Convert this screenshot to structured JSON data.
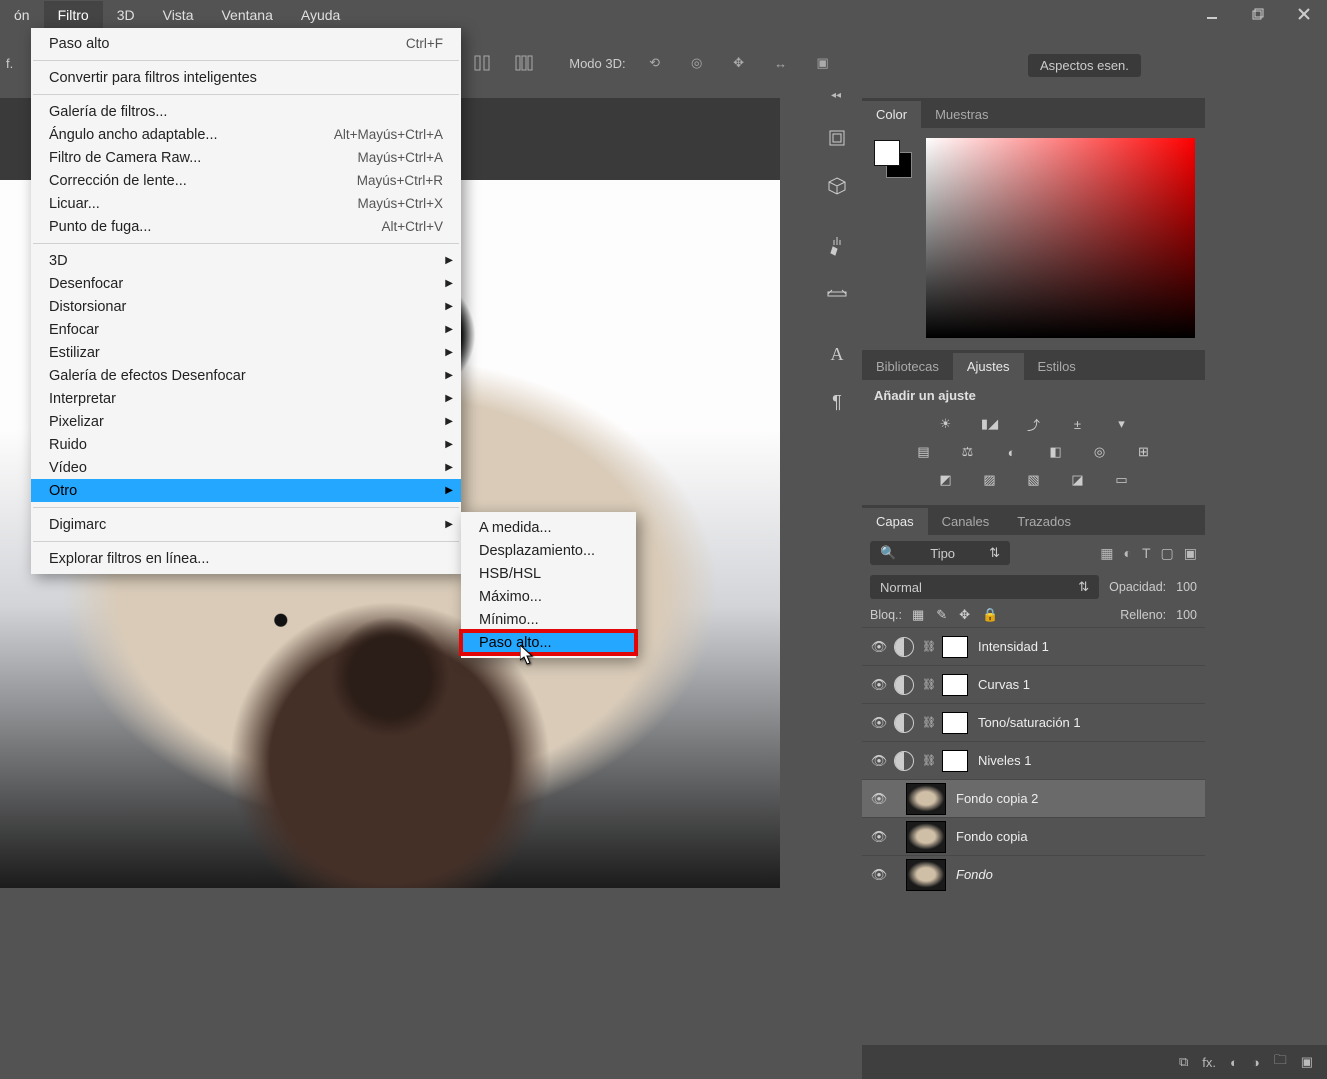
{
  "menubar": {
    "items_pre": "ón",
    "items": [
      "Filtro",
      "3D",
      "Vista",
      "Ventana",
      "Ayuda"
    ],
    "open_index": 0
  },
  "optionsbar": {
    "left": "f.",
    "modo3d_label": "Modo 3D:"
  },
  "aspectos_label": "Aspectos esen.",
  "filter_menu": {
    "sections": [
      [
        {
          "label": "Paso alto",
          "shortcut": "Ctrl+F"
        }
      ],
      [
        {
          "label": "Convertir para filtros inteligentes"
        }
      ],
      [
        {
          "label": "Galería de filtros..."
        },
        {
          "label": "Ángulo ancho adaptable...",
          "shortcut": "Alt+Mayús+Ctrl+A"
        },
        {
          "label": "Filtro de Camera Raw...",
          "shortcut": "Mayús+Ctrl+A"
        },
        {
          "label": "Corrección de lente...",
          "shortcut": "Mayús+Ctrl+R"
        },
        {
          "label": "Licuar...",
          "shortcut": "Mayús+Ctrl+X"
        },
        {
          "label": "Punto de fuga...",
          "shortcut": "Alt+Ctrl+V"
        }
      ],
      [
        {
          "label": "3D",
          "submenu": true
        },
        {
          "label": "Desenfocar",
          "submenu": true
        },
        {
          "label": "Distorsionar",
          "submenu": true
        },
        {
          "label": "Enfocar",
          "submenu": true
        },
        {
          "label": "Estilizar",
          "submenu": true
        },
        {
          "label": "Galería de efectos Desenfocar",
          "submenu": true
        },
        {
          "label": "Interpretar",
          "submenu": true
        },
        {
          "label": "Pixelizar",
          "submenu": true
        },
        {
          "label": "Ruido",
          "submenu": true
        },
        {
          "label": "Vídeo",
          "submenu": true
        },
        {
          "label": "Otro",
          "submenu": true,
          "selected": true
        }
      ],
      [
        {
          "label": "Digimarc",
          "submenu": true
        }
      ],
      [
        {
          "label": "Explorar filtros en línea..."
        }
      ]
    ]
  },
  "submenu_otro": [
    {
      "label": "A medida..."
    },
    {
      "label": "Desplazamiento..."
    },
    {
      "label": "HSB/HSL"
    },
    {
      "label": "Máximo..."
    },
    {
      "label": "Mínimo..."
    },
    {
      "label": "Paso alto...",
      "selected": true,
      "highlight": true
    }
  ],
  "panels": {
    "color_tabs": [
      "Color",
      "Muestras"
    ],
    "mid_tabs": [
      "Bibliotecas",
      "Ajustes",
      "Estilos"
    ],
    "mid_active": 1,
    "adjust_label": "Añadir un ajuste",
    "bottom_tabs": [
      "Capas",
      "Canales",
      "Trazados"
    ],
    "bottom_active": 0,
    "type_select_icon": "🔍",
    "type_select_label": "Tipo",
    "blend_mode": "Normal",
    "opacity_label": "Opacidad:",
    "opacity_value": "100",
    "lock_label": "Bloq.:",
    "fill_label": "Relleno:",
    "fill_value": "100",
    "layers": [
      {
        "name": "Intensidad 1",
        "adjustment": true
      },
      {
        "name": "Curvas 1",
        "adjustment": true
      },
      {
        "name": "Tono/saturación 1",
        "adjustment": true
      },
      {
        "name": "Niveles 1",
        "adjustment": true
      },
      {
        "name": "Fondo copia 2",
        "image": true,
        "selected": true
      },
      {
        "name": "Fondo copia",
        "image": true
      },
      {
        "name": "Fondo",
        "image": true,
        "italic": true
      }
    ]
  },
  "layers_bottom_fx": "fx."
}
